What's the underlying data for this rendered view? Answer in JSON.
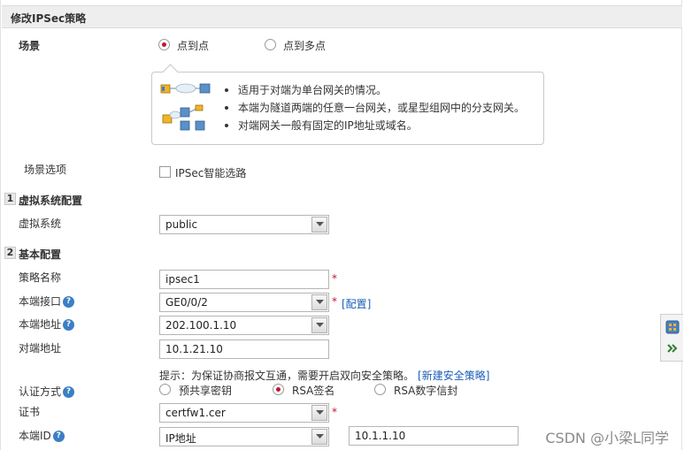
{
  "title": "修改IPSec策略",
  "scene": {
    "label": "场景",
    "options": [
      "点到点",
      "点到多点"
    ],
    "selected": "点到点",
    "info_lines": [
      "适用于对端为单台网关的情况。",
      "本端为隧道两端的任意一台网关，或星型组网中的分支网关。",
      "对端网关一般有固定的IP地址或域名。"
    ]
  },
  "scene_options": {
    "label": "场景选项",
    "checkbox_label": "IPSec智能选路",
    "checked": false
  },
  "section_virtual": {
    "number": "1",
    "title": "虚拟系统配置",
    "vsys_label": "虚拟系统",
    "vsys_value": "public"
  },
  "section_basic": {
    "number": "2",
    "title": "基本配置",
    "policy_name_label": "策略名称",
    "policy_name_value": "ipsec1",
    "local_interface_label": "本端接口",
    "local_interface_value": "GE0/0/2",
    "config_link": "[配置]",
    "local_address_label": "本端地址",
    "local_address_value": "202.100.1.10",
    "peer_address_label": "对端地址",
    "peer_address_value": "10.1.21.10",
    "hint_text": "提示：为保证协商报文互通，需要开启双向安全策略。",
    "hint_link": "[新建安全策略]",
    "auth_label": "认证方式",
    "auth_options": [
      "预共享密钥",
      "RSA签名",
      "RSA数字信封"
    ],
    "auth_selected": "RSA签名",
    "cert_label": "证书",
    "cert_value": "certfw1.cer",
    "local_id_label": "本端ID",
    "local_id_type": "IP地址",
    "local_id_value": "10.1.1.10",
    "required_mark": "*",
    "help_mark": "?"
  },
  "watermark": "CSDN @小梁L同学",
  "colors": {
    "accent": "#c8102e",
    "link": "#1a5fb4",
    "help_icon": "#3b7fc4"
  }
}
